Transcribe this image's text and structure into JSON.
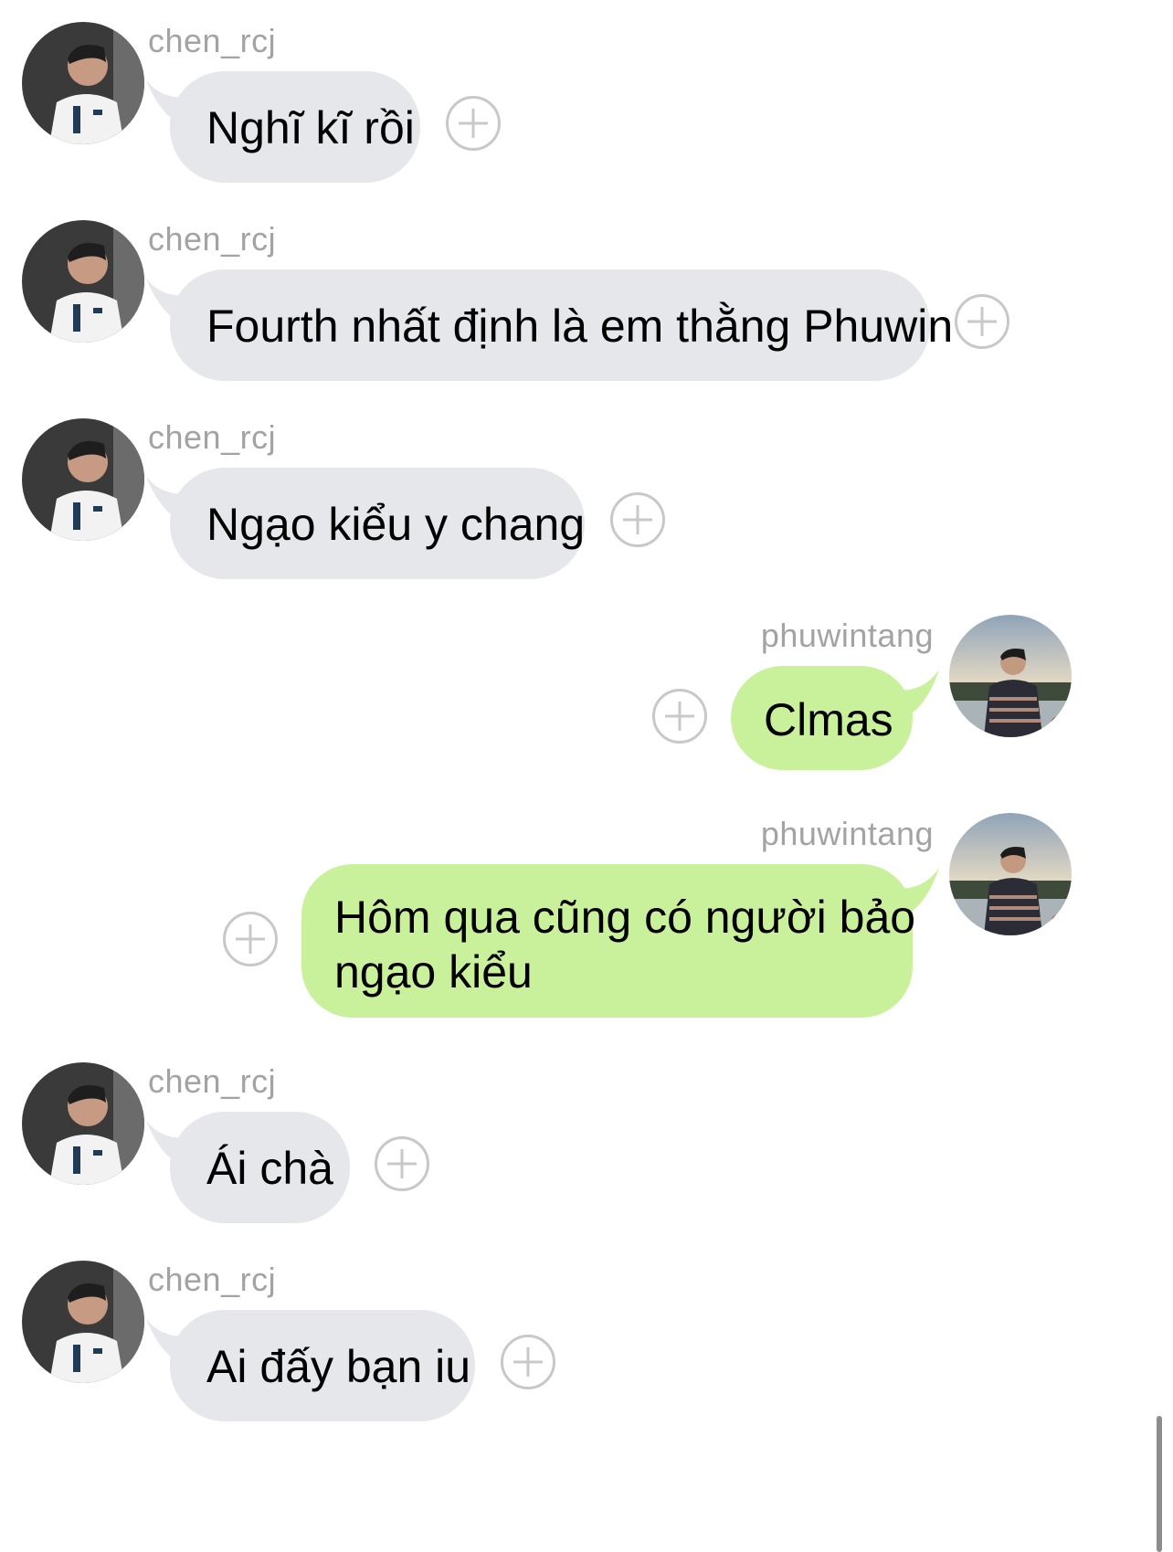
{
  "messages": [
    {
      "sender": "chen_rcj",
      "text": "Nghĩ kĩ rồi",
      "direction": "incoming"
    },
    {
      "sender": "chen_rcj",
      "text": "Fourth nhất định là em thằng Phuwin",
      "direction": "incoming"
    },
    {
      "sender": "chen_rcj",
      "text": "Ngạo kiểu y chang",
      "direction": "incoming"
    },
    {
      "sender": "phuwintang",
      "text": "Clmas",
      "direction": "outgoing"
    },
    {
      "sender": "phuwintang",
      "text_line1": "Hôm qua cũng có người bảo",
      "text_line2": "ngạo kiểu",
      "direction": "outgoing"
    },
    {
      "sender": "chen_rcj",
      "text": "Ái chà",
      "direction": "incoming"
    },
    {
      "sender": "chen_rcj",
      "text": "Ai đấy bạn iu",
      "direction": "incoming"
    }
  ],
  "colors": {
    "incoming_bubble": "#e5e7eb",
    "outgoing_bubble": "#c9f09a",
    "sender_name": "#a3a3a3",
    "add_button": "#c8c8c8"
  },
  "icons": {
    "add_reaction": "plus-circle-icon",
    "avatar_chen": "photo-avatar",
    "avatar_phuwin": "photo-avatar"
  }
}
